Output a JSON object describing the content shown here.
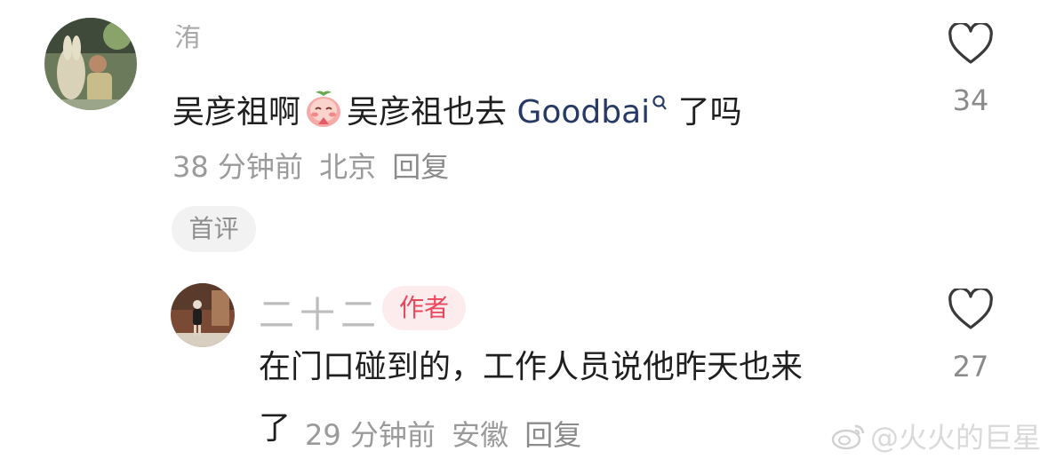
{
  "comments": [
    {
      "username_partial": "洧",
      "text_before_emoji": "吴彦祖啊",
      "emoji": "peach-blessing-emoji",
      "text_after_emoji": "吴彦祖也去 ",
      "link_text": "Goodbai",
      "link_icon": "search-icon",
      "text_after_link": " 了吗",
      "time": "38 分钟前",
      "location": "北京",
      "reply_label": "回复",
      "badge": "首评",
      "likes": "34"
    }
  ],
  "reply": {
    "username": "二十二",
    "badge": "作者",
    "text_line1": "在门口碰到的，工作人员说他昨天也来",
    "text_line2": "了",
    "time": "29 分钟前",
    "location": "安徽",
    "reply_label": "回复",
    "likes": "27"
  },
  "watermark": {
    "text": "@火火的巨星",
    "icon": "weibo-icon"
  },
  "colors": {
    "author_badge_text": "#e8475c",
    "author_badge_bg": "#fdecee",
    "link": "#273a66",
    "meta": "#9a9a9a"
  }
}
